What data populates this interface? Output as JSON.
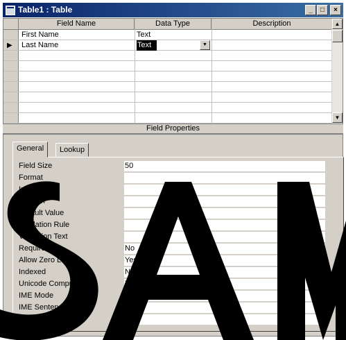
{
  "window": {
    "title": "Table1 : Table",
    "minimize": "_",
    "maximize": "□",
    "close": "×"
  },
  "grid": {
    "headers": [
      "Field Name",
      "Data Type",
      "Description"
    ],
    "rows": [
      {
        "field_name": "First Name",
        "data_type": "Text",
        "description": ""
      },
      {
        "field_name": "Last Name",
        "data_type": "Text",
        "description": ""
      }
    ],
    "current_row_indicator": "▶",
    "dropdown_arrow": "▼"
  },
  "field_properties_label": "Field Properties",
  "tabs": [
    "General",
    "Lookup"
  ],
  "properties": [
    {
      "label": "Field Size",
      "value": "50"
    },
    {
      "label": "Format",
      "value": ""
    },
    {
      "label": "Input Mask",
      "value": ""
    },
    {
      "label": "Caption",
      "value": ""
    },
    {
      "label": "Default Value",
      "value": ""
    },
    {
      "label": "Validation Rule",
      "value": ""
    },
    {
      "label": "Validation Text",
      "value": ""
    },
    {
      "label": "Required",
      "value": "No"
    },
    {
      "label": "Allow Zero Length",
      "value": "Yes"
    },
    {
      "label": "Indexed",
      "value": "No"
    },
    {
      "label": "Unicode Compression",
      "value": "Yes"
    },
    {
      "label": "IME Mode",
      "value": "No Control"
    },
    {
      "label": "IME Sentence Mode",
      "value": "None"
    },
    {
      "label": "Smart Tags",
      "value": ""
    }
  ],
  "colors": {
    "titlebar_start": "#0a246a",
    "titlebar_end": "#3a6ea5",
    "face": "#d4d0c8",
    "watermark": "#000000"
  }
}
